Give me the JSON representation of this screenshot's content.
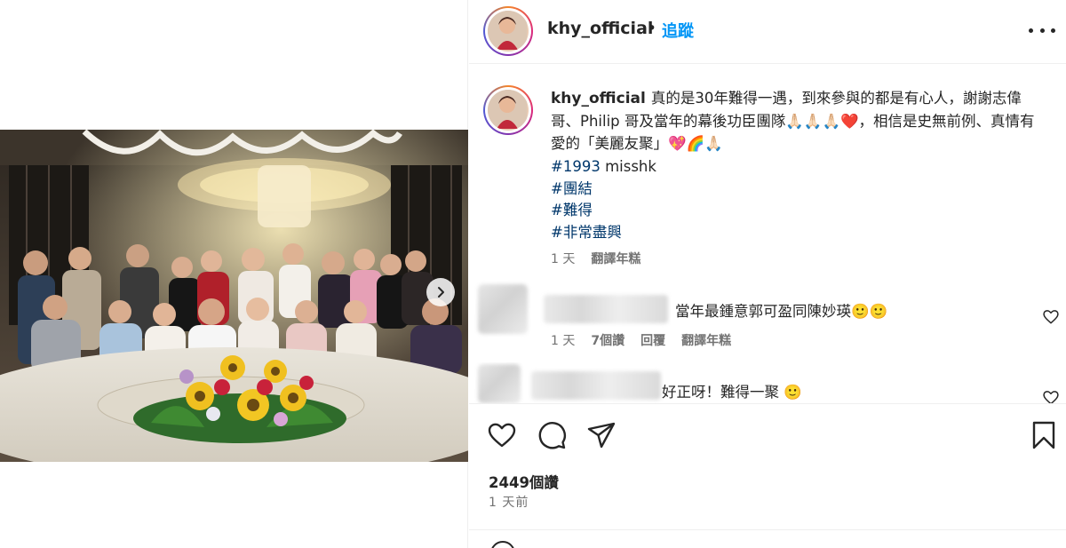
{
  "post": {
    "author": "khy_official",
    "separator": "•",
    "follow_label": "追蹤",
    "caption": "真的是30年難得一遇，到來參與的都是有心人，謝謝志偉哥、Philip 哥及當年的幕後功臣團隊🙏🏻🙏🏻🙏🏻❤️，相信是史無前例、真情有愛的「美麗友聚」💖🌈🙏🏻",
    "hashtags": [
      {
        "tag": "#1993",
        "suffix": " misshk"
      },
      {
        "tag": "#團結",
        "suffix": ""
      },
      {
        "tag": "#難得",
        "suffix": ""
      },
      {
        "tag": "#非常盡興",
        "suffix": ""
      }
    ],
    "caption_time": "1 天",
    "translate_label": "翻譯年糕",
    "likes_label": "2449個讚",
    "post_time": "1 天前"
  },
  "comments": [
    {
      "text": "當年最鍾意郭可盈同陳妙瑛🙂🙂",
      "time": "1 天",
      "likes": "7個讚",
      "reply_label": "回覆",
      "translate_label": "翻譯年糕"
    },
    {
      "text": "好正呀！難得一聚 🙂"
    }
  ],
  "icons": {
    "more": "more-options-icon",
    "like": "heart-icon",
    "comment": "comment-icon",
    "share": "share-icon",
    "save": "bookmark-icon",
    "next": "chevron-right-icon",
    "emoji": "emoji-icon"
  },
  "colors": {
    "link": "#0095f6",
    "hashtag": "#00376b",
    "secondary_text": "#737373",
    "primary_text": "#262626"
  }
}
